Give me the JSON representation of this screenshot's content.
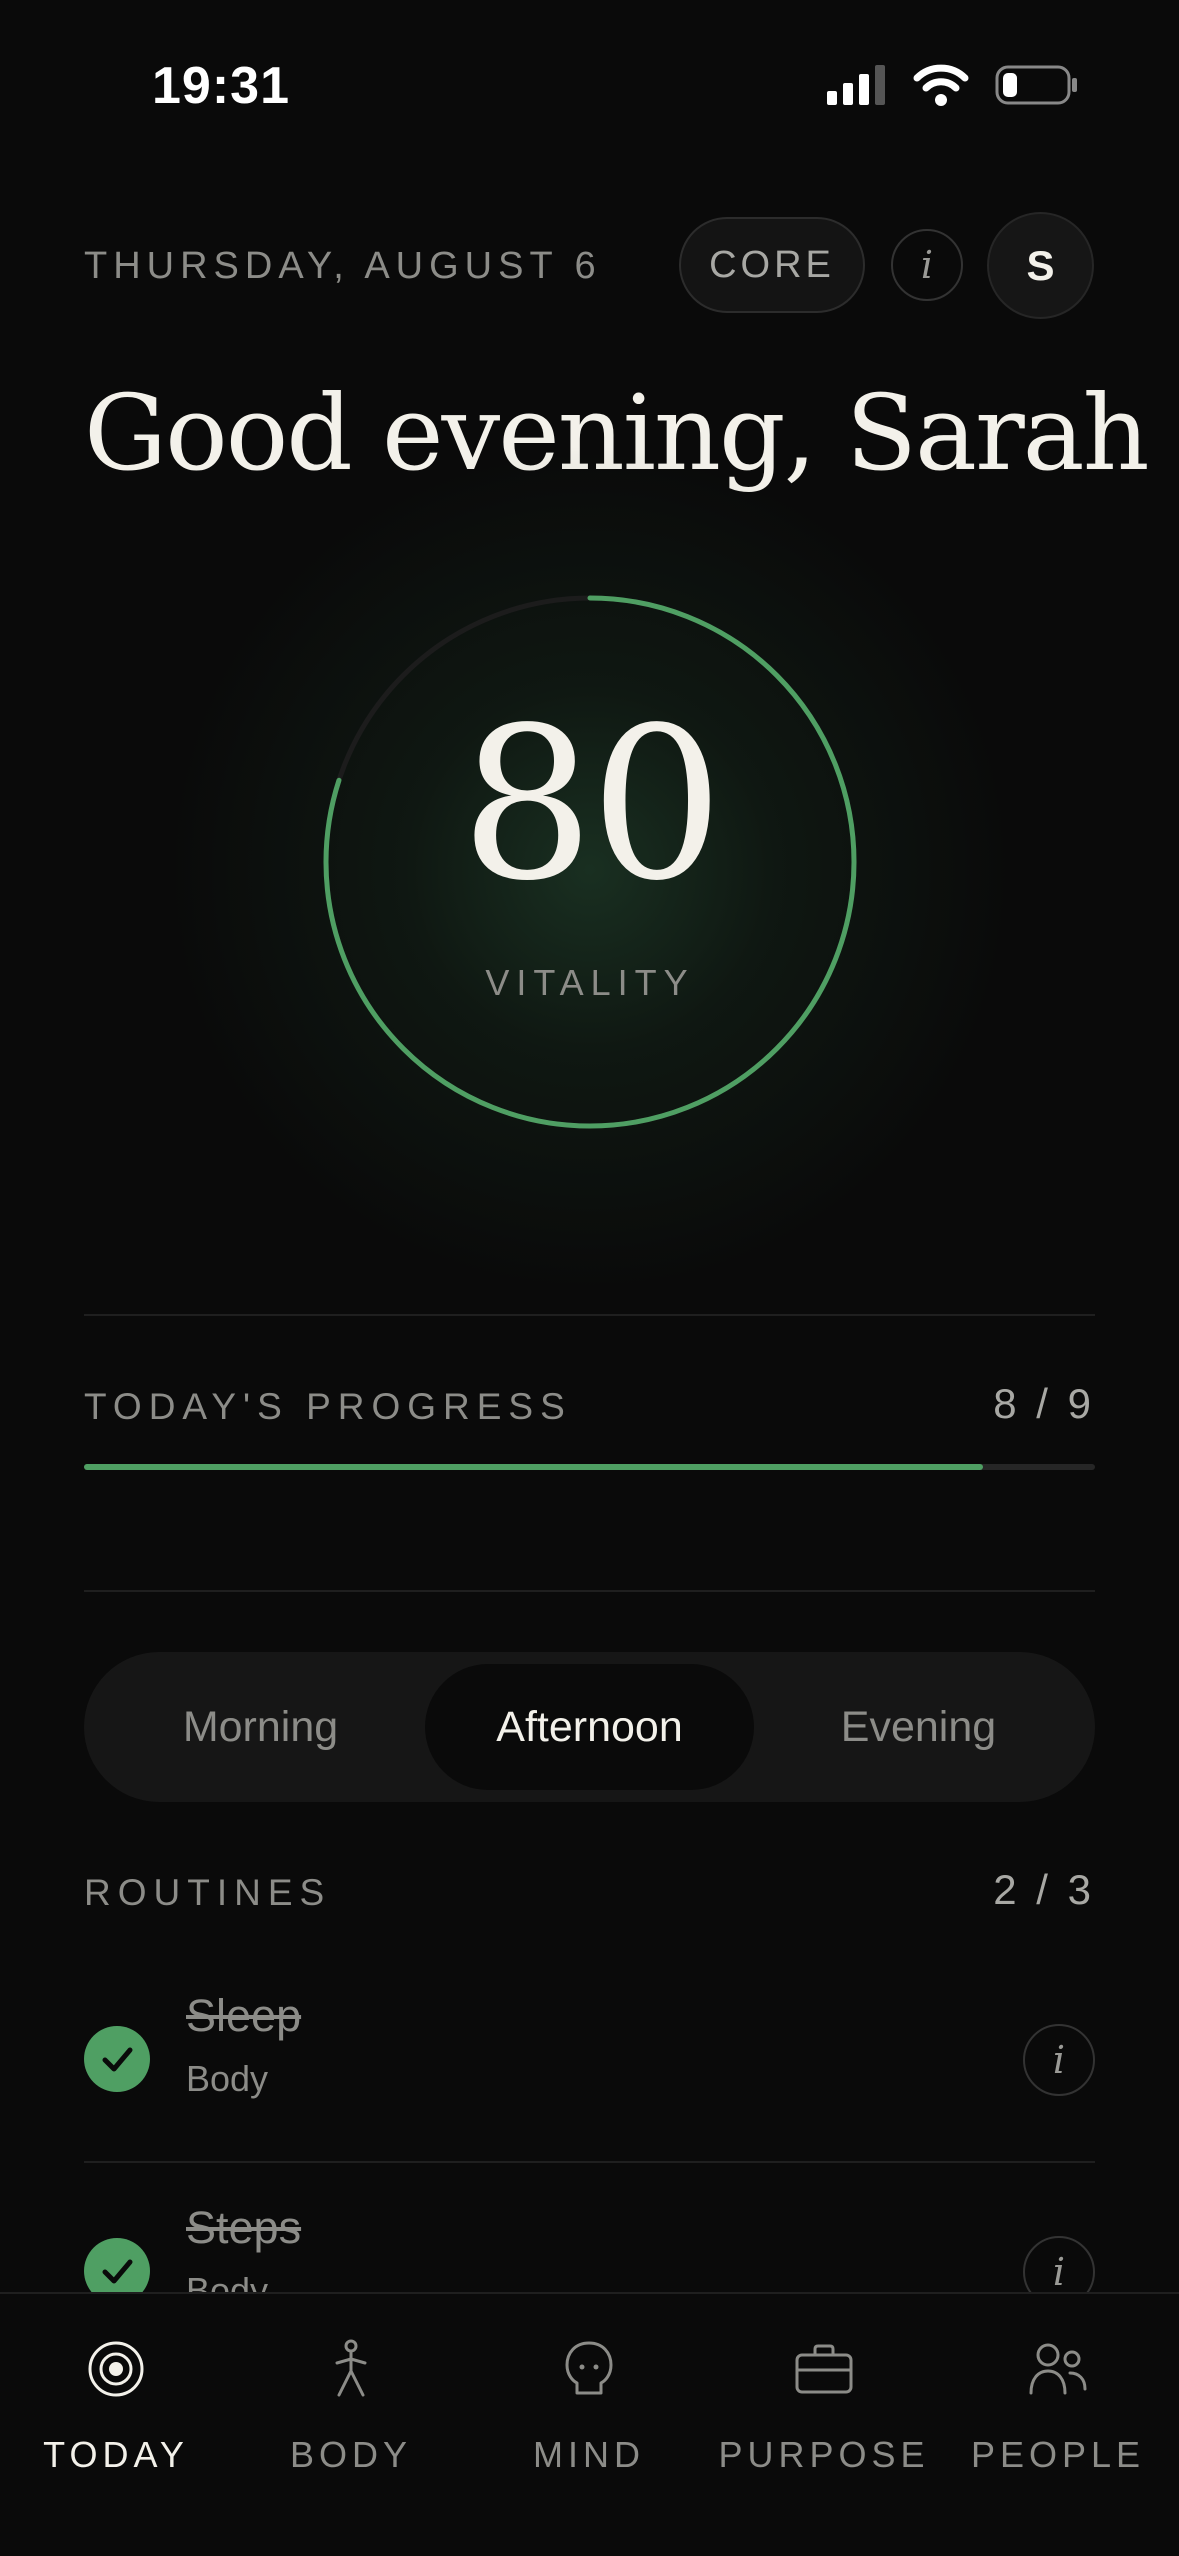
{
  "status_bar": {
    "time": "19:31"
  },
  "header": {
    "date": "THURSDAY, AUGUST 6",
    "tier_badge": "CORE",
    "info_glyph": "i",
    "avatar_initial": "S",
    "greeting": "Good evening, Sarah"
  },
  "vitality": {
    "score": "80",
    "label": "VITALITY",
    "ring_fraction": 0.8
  },
  "progress": {
    "label": "TODAY'S PROGRESS",
    "count": "8 / 9",
    "fraction": 0.889
  },
  "time_of_day": {
    "options": [
      "Morning",
      "Afternoon",
      "Evening"
    ],
    "selected": "Afternoon"
  },
  "routines": {
    "label": "ROUTINES",
    "count": "2 / 3",
    "items": [
      {
        "title": "Sleep",
        "category": "Body",
        "done": true
      },
      {
        "title": "Steps",
        "category": "Body",
        "done": true
      }
    ]
  },
  "tabbar": {
    "tabs": [
      {
        "label": "TODAY",
        "icon": "target-icon"
      },
      {
        "label": "BODY",
        "icon": "person-icon"
      },
      {
        "label": "MIND",
        "icon": "head-icon"
      },
      {
        "label": "PURPOSE",
        "icon": "briefcase-icon"
      },
      {
        "label": "PEOPLE",
        "icon": "people-icon"
      }
    ],
    "active": "TODAY"
  },
  "colors": {
    "accent": "#4f9f63",
    "background": "#0a0a0a",
    "text": "#f3f1ea",
    "muted": "#8c8c88"
  }
}
